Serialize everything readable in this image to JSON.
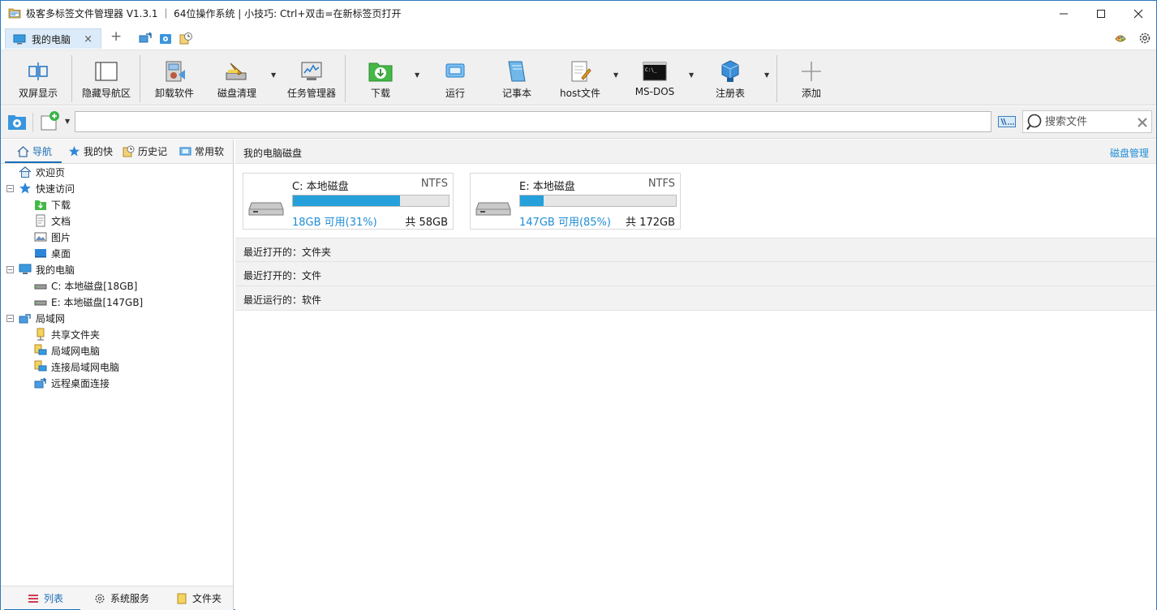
{
  "window": {
    "title": "极客多标签文件管理器 V1.3.1 ｜ 64位操作系统 | 小技巧: Ctrl+双击=在新标签页打开"
  },
  "tabs": [
    {
      "label": "我的电脑",
      "close_icon": "×"
    }
  ],
  "tab_add": "+",
  "toolbar": {
    "items": [
      {
        "label": "双屏显示",
        "icon": "split-screen-icon"
      },
      {
        "label": "隐藏导航区",
        "icon": "panel-icon"
      },
      {
        "label": "卸载软件",
        "icon": "uninstall-icon"
      },
      {
        "label": "磁盘清理",
        "icon": "disk-cleanup-icon"
      },
      {
        "label": "任务管理器",
        "icon": "task-manager-icon"
      },
      {
        "label": "下载",
        "icon": "download-folder-icon"
      },
      {
        "label": "运行",
        "icon": "run-icon"
      },
      {
        "label": "记事本",
        "icon": "notepad-icon"
      },
      {
        "label": "host文件",
        "icon": "host-file-icon"
      },
      {
        "label": "MS-DOS",
        "icon": "cmd-icon"
      },
      {
        "label": "注册表",
        "icon": "registry-icon"
      },
      {
        "label": "添加",
        "icon": "plus-icon"
      }
    ]
  },
  "address": {
    "value": ""
  },
  "search": {
    "placeholder": "搜索文件"
  },
  "nav_tabs": [
    {
      "label": "导航"
    },
    {
      "label": "我的快"
    },
    {
      "label": "历史记"
    },
    {
      "label": "常用软"
    }
  ],
  "tree": {
    "welcome": "欢迎页",
    "quick_access": "快速访问",
    "download": "下载",
    "documents": "文档",
    "pictures": "图片",
    "desktop": "桌面",
    "my_computer": "我的电脑",
    "disk_c": "C: 本地磁盘[18GB]",
    "disk_e": "E: 本地磁盘[147GB]",
    "lan": "局域网",
    "shared_folder": "共享文件夹",
    "lan_computer": "局域网电脑",
    "connect_lan": "连接局域网电脑",
    "remote_desktop": "远程桌面连接"
  },
  "bottom_tabs": [
    {
      "label": "列表"
    },
    {
      "label": "系统服务"
    },
    {
      "label": "文件夹"
    }
  ],
  "main": {
    "disks_title": "我的电脑磁盘",
    "disk_manage_link": "磁盘管理",
    "disks": [
      {
        "name": "C: 本地磁盘",
        "fs": "NTFS",
        "free": "18GB 可用(31%)",
        "total": "共 58GB",
        "used_fraction": 0.69
      },
      {
        "name": "E: 本地磁盘",
        "fs": "NTFS",
        "free": "147GB 可用(85%)",
        "total": "共 172GB",
        "used_fraction": 0.15
      }
    ],
    "recent_folders": "最近打开的：文件夹",
    "recent_files": "最近打开的：文件",
    "recent_software": "最近运行的：软件"
  },
  "colors": {
    "accent": "#1f8dd6",
    "bar_fill": "#26a0da",
    "toolbar_bg": "#f0f0f0"
  }
}
